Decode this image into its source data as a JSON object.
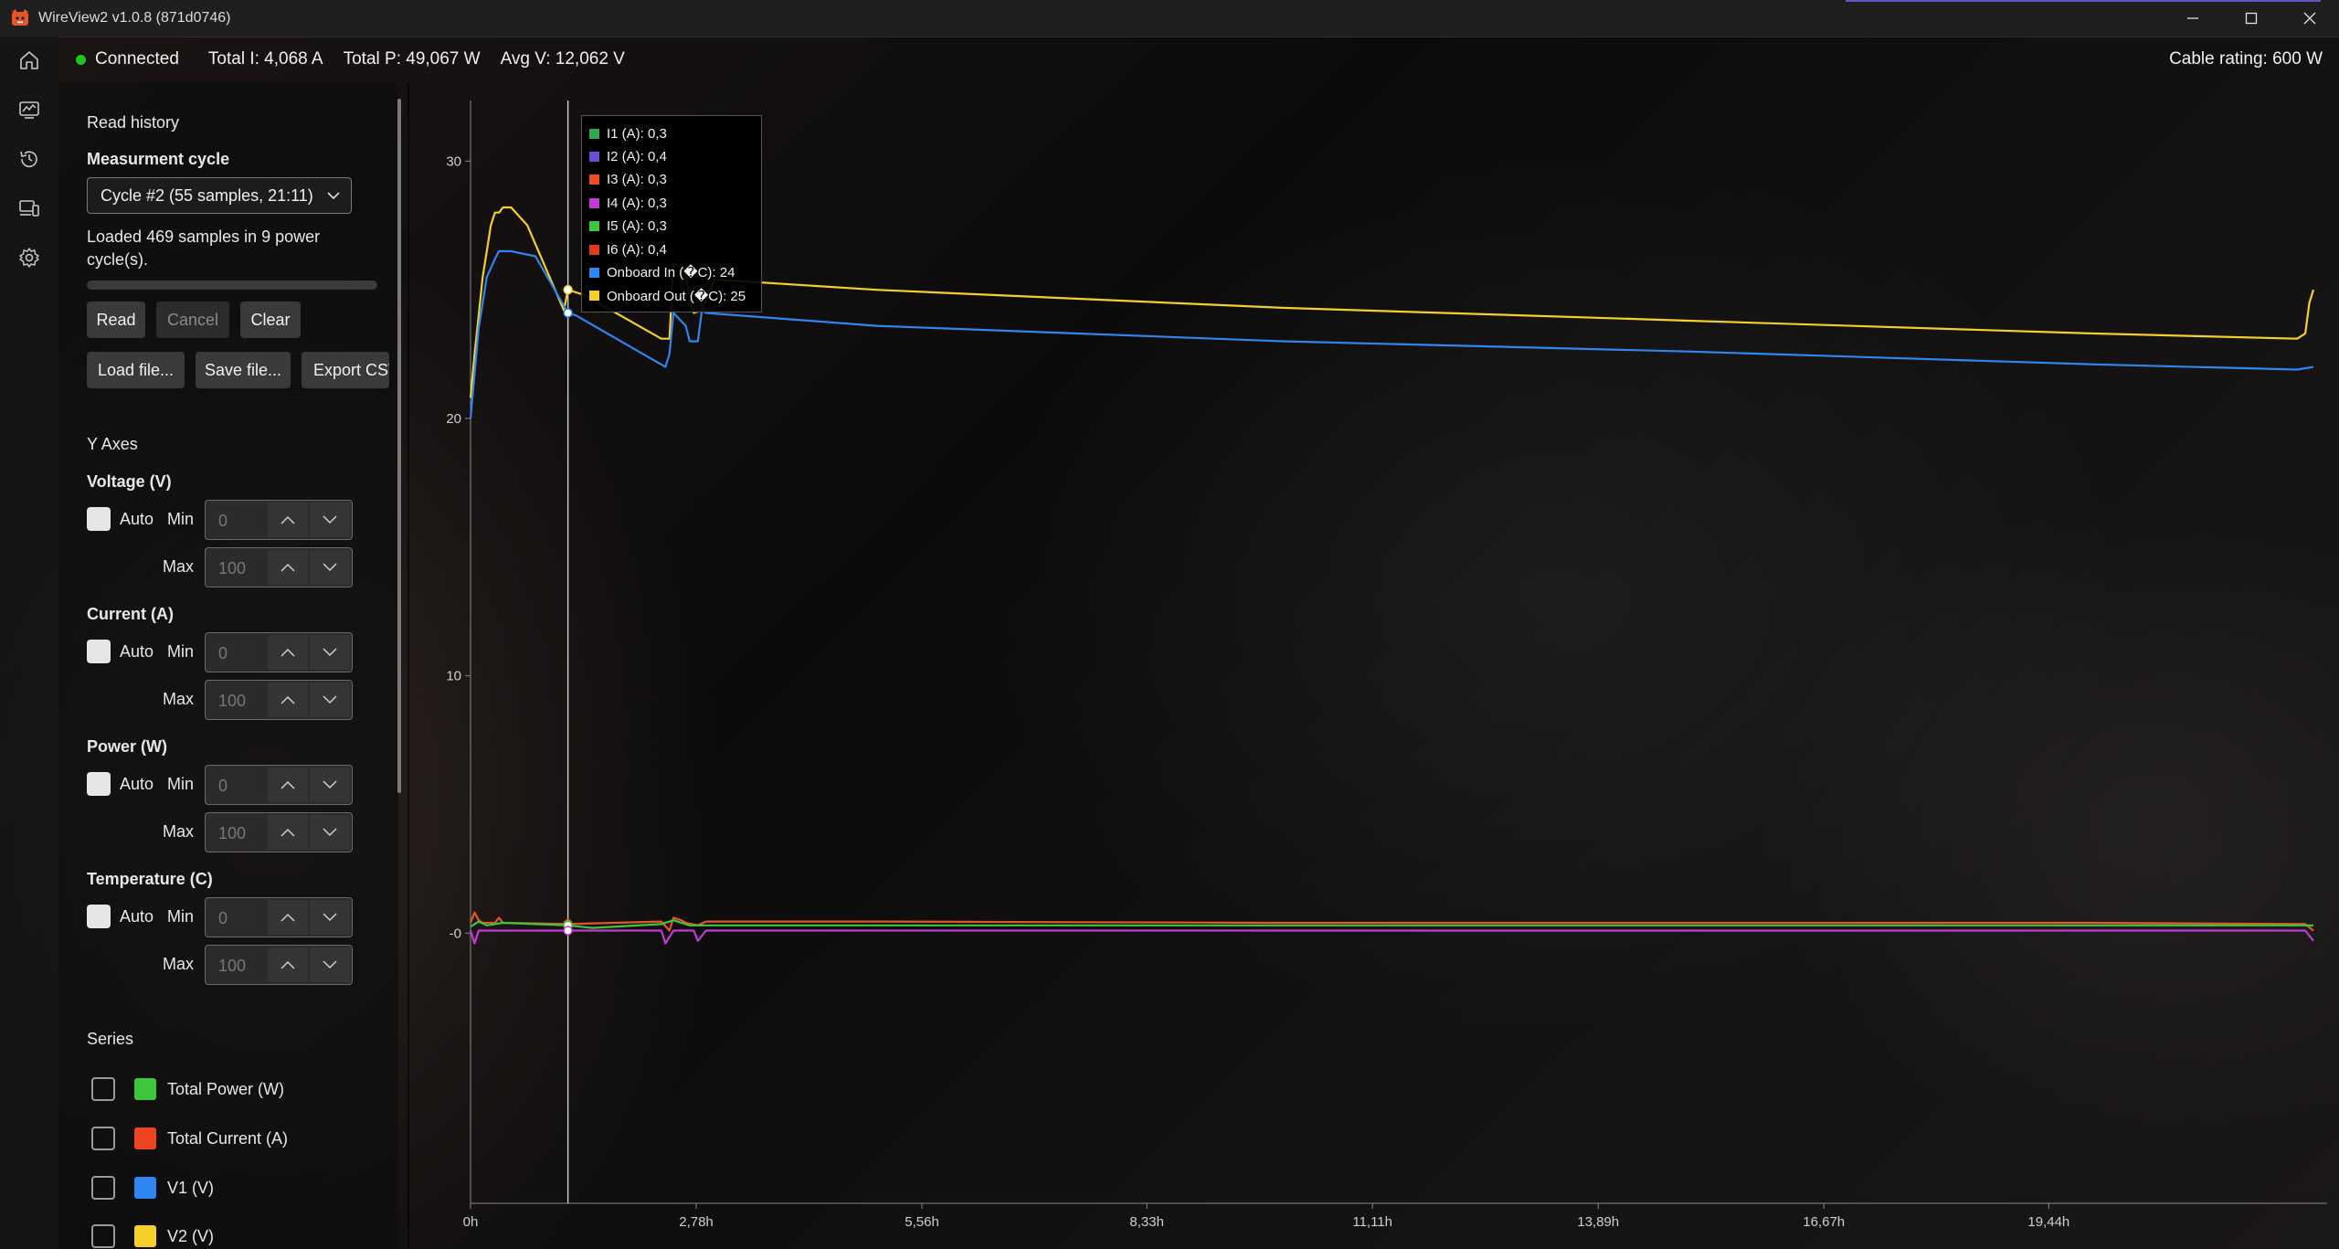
{
  "window": {
    "title": "WireView2 v1.0.8 (871d0746)"
  },
  "status": {
    "connection": "Connected",
    "total_current": "Total I: 4,068 A",
    "total_power": "Total P: 49,067 W",
    "avg_voltage": "Avg V: 12,062 V",
    "cable_rating": "Cable rating: 600 W"
  },
  "panel": {
    "read_history": "Read history",
    "measurement_cycle_label": "Measurment cycle",
    "cycle_selected": "Cycle #2 (55 samples, 21:11)",
    "loaded_info_line1": "Loaded 469 samples in 9 power",
    "loaded_info_line2": "cycle(s).",
    "buttons": {
      "read": "Read",
      "cancel": "Cancel",
      "clear": "Clear",
      "load_file": "Load file...",
      "save_file": "Save file...",
      "export_csv": "Export CSV"
    },
    "y_axes_label": "Y Axes",
    "axes": [
      {
        "label": "Voltage (V)",
        "auto": "Auto",
        "min_label": "Min",
        "max_label": "Max",
        "min": "0",
        "max": "100"
      },
      {
        "label": "Current (A)",
        "auto": "Auto",
        "min_label": "Min",
        "max_label": "Max",
        "min": "0",
        "max": "100"
      },
      {
        "label": "Power (W)",
        "auto": "Auto",
        "min_label": "Min",
        "max_label": "Max",
        "min": "0",
        "max": "100"
      },
      {
        "label": "Temperature (C)",
        "auto": "Auto",
        "min_label": "Min",
        "max_label": "Max",
        "min": "0",
        "max": "100"
      }
    ],
    "series_label": "Series",
    "series": [
      {
        "label": "Total Power (W)",
        "color": "#3ec63e"
      },
      {
        "label": "Total Current (A)",
        "color": "#ee4422"
      },
      {
        "label": "V1 (V)",
        "color": "#2f86f0"
      },
      {
        "label": "V2 (V)",
        "color": "#f5cf2a"
      }
    ]
  },
  "tooltip": [
    {
      "label": "I1 (A): 0,3",
      "color": "#2fa84f"
    },
    {
      "label": "I2 (A): 0,4",
      "color": "#6a4fd6"
    },
    {
      "label": "I3 (A): 0,3",
      "color": "#ee4b2b"
    },
    {
      "label": "I4 (A): 0,3",
      "color": "#c23ad6"
    },
    {
      "label": "I5 (A): 0,3",
      "color": "#3ec63e"
    },
    {
      "label": "I6 (A): 0,4",
      "color": "#e03a1e"
    },
    {
      "label": "Onboard In (�C): 24",
      "color": "#2f86f0"
    },
    {
      "label": "Onboard Out (�C): 25",
      "color": "#f5cf2a"
    }
  ],
  "chart_data": {
    "type": "line",
    "x_unit": "h",
    "xlim": [
      0,
      22.7
    ],
    "ylim": [
      -10.5,
      32
    ],
    "x_ticks": [
      0,
      2.78,
      5.56,
      8.33,
      11.11,
      13.89,
      16.67,
      19.44
    ],
    "x_tick_labels": [
      "0h",
      "2,78h",
      "5,56h",
      "8,33h",
      "11,11h",
      "13,89h",
      "16,67h",
      "19,44h"
    ],
    "y_ticks": [
      0,
      10,
      20,
      30
    ],
    "y_tick_labels": [
      "-0",
      "10",
      "20",
      "30"
    ],
    "cursor_x": 1.2,
    "grid": false,
    "series": [
      {
        "name": "Onboard Out (�C)",
        "color": "#f5cf2a",
        "x": [
          0,
          0.05,
          0.1,
          0.15,
          0.2,
          0.25,
          0.3,
          0.35,
          0.4,
          0.5,
          0.7,
          1.15,
          1.2,
          1.4,
          2.35,
          2.45,
          2.5,
          2.65,
          2.68,
          2.75,
          2.85,
          3.0,
          5.0,
          10.0,
          15.0,
          20.0,
          22.5,
          22.6,
          22.65,
          22.7
        ],
        "y": [
          20.8,
          22.5,
          24,
          25.5,
          26.5,
          27.5,
          28,
          28,
          28.2,
          28.2,
          27.5,
          24.2,
          25,
          24.8,
          23.1,
          23.1,
          26,
          25.8,
          25,
          24.1,
          24.2,
          25.4,
          25,
          24.3,
          23.8,
          23.3,
          23.1,
          23.3,
          24.5,
          25
        ]
      },
      {
        "name": "Onboard In (�C)",
        "color": "#2f86f0",
        "x": [
          0,
          0.1,
          0.2,
          0.3,
          0.35,
          0.45,
          0.5,
          0.8,
          1.2,
          1.3,
          2.4,
          2.45,
          2.5,
          2.65,
          2.7,
          2.8,
          2.85,
          2.9,
          5.0,
          10.0,
          15.0,
          20.0,
          22.5,
          22.7
        ],
        "y": [
          20,
          23.5,
          25.5,
          26.2,
          26.5,
          26.5,
          26.5,
          26.3,
          24.1,
          24,
          22,
          22.5,
          24.1,
          23.6,
          23,
          23,
          24.2,
          24.1,
          23.6,
          23,
          22.6,
          22.1,
          21.9,
          22
        ]
      },
      {
        "name": "Total Current (A)",
        "color": "#e8542a",
        "x": [
          0,
          0.05,
          0.1,
          0.15,
          0.3,
          0.35,
          0.4,
          1.2,
          2.35,
          2.45,
          2.5,
          2.6,
          2.65,
          2.8,
          2.9,
          5.0,
          10.0,
          15.0,
          20.0,
          22.6,
          22.7
        ],
        "y": [
          0.4,
          0.8,
          0.5,
          0.4,
          0.4,
          0.6,
          0.4,
          0.35,
          0.45,
          0.1,
          0.6,
          0.5,
          0.4,
          0.3,
          0.45,
          0.45,
          0.4,
          0.4,
          0.4,
          0.35,
          0.1
        ]
      },
      {
        "name": "Total Power (W)",
        "color": "#3ec63e",
        "x": [
          0,
          0.1,
          0.2,
          0.4,
          1.2,
          1.5,
          2.35,
          2.5,
          2.7,
          2.9,
          5.0,
          10.0,
          20.0,
          22.7
        ],
        "y": [
          0.25,
          0.45,
          0.3,
          0.4,
          0.3,
          0.2,
          0.35,
          0.5,
          0.3,
          0.3,
          0.3,
          0.3,
          0.3,
          0.3
        ]
      },
      {
        "name": "I4 (A)",
        "color": "#c23ad6",
        "x": [
          0,
          0.05,
          0.1,
          0.3,
          1.2,
          2.35,
          2.4,
          2.5,
          2.75,
          2.8,
          2.9,
          5.0,
          10.0,
          20.0,
          22.6,
          22.7
        ],
        "y": [
          0.1,
          -0.4,
          0.1,
          0.1,
          0.1,
          0.1,
          -0.4,
          0.1,
          0.1,
          -0.3,
          0.1,
          0.1,
          0.1,
          0.1,
          0.1,
          -0.3
        ]
      }
    ]
  }
}
